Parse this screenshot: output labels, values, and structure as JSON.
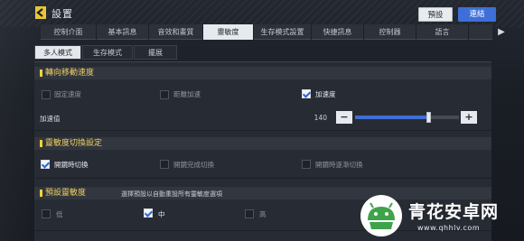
{
  "header": {
    "title": "設置",
    "preset_label": "預設",
    "connect_label": "連結"
  },
  "tabs": [
    {
      "label": "控制介面",
      "active": false
    },
    {
      "label": "基本訊息",
      "active": false
    },
    {
      "label": "音效和畫質",
      "active": false
    },
    {
      "label": "靈敏度",
      "active": true
    },
    {
      "label": "生存模式設置",
      "active": false
    },
    {
      "label": "快捷訊息",
      "active": false
    },
    {
      "label": "控制器",
      "active": false
    },
    {
      "label": "語言",
      "active": false
    }
  ],
  "subtabs": [
    {
      "label": "多人模式",
      "active": true
    },
    {
      "label": "生存模式",
      "active": false
    },
    {
      "label": "擺展",
      "active": false
    }
  ],
  "sections": {
    "turn": {
      "title": "轉向移動速度",
      "options": [
        {
          "label": "固定速度",
          "checked": false
        },
        {
          "label": "距離加速",
          "checked": false
        },
        {
          "label": "加速度",
          "checked": true
        }
      ],
      "accel_label": "加速值",
      "accel_value": "140",
      "accel_fraction": 0.7,
      "minus": "−",
      "plus": "+"
    },
    "switch": {
      "title": "靈敏度切換設定",
      "options": [
        {
          "label": "開鏡時切換",
          "checked": true
        },
        {
          "label": "開鏡完成切換",
          "checked": false
        },
        {
          "label": "開鏡時逐漸切換",
          "checked": false
        }
      ]
    },
    "preset": {
      "title": "預設靈敏度",
      "note": "選擇預設以自動重設所有靈敏度選項",
      "options": [
        {
          "label": "低",
          "checked": false
        },
        {
          "label": "中",
          "checked": true
        },
        {
          "label": "高",
          "checked": false
        }
      ]
    }
  },
  "watermark": {
    "text": "青花安卓网",
    "url": "www.qhhlv.com"
  },
  "colors": {
    "accent_blue": "#3e6fd8",
    "section_yellow": "#f0d060",
    "watermark_green": "#3fa34a"
  }
}
